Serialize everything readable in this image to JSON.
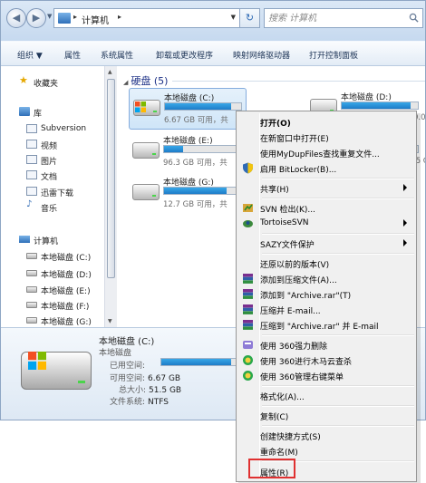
{
  "address": {
    "path": "计算机",
    "search_placeholder": "搜索 计算机"
  },
  "toolbar": {
    "organize": "组织 ▼",
    "properties": "属性",
    "system_properties": "系统属性",
    "uninstall": "卸载或更改程序",
    "map_drive": "映射网络驱动器",
    "control_panel": "打开控制面板"
  },
  "nav": {
    "favorites": "收藏夹",
    "library": "库",
    "subversion": "Subversion",
    "videos": "视频",
    "pictures": "图片",
    "documents": "文档",
    "xunlei": "迅雷下载",
    "music": "音乐",
    "computer": "计算机",
    "drives": [
      "本地磁盘 (C:)",
      "本地磁盘 (D:)",
      "本地磁盘 (E:)",
      "本地磁盘 (F:)",
      "本地磁盘 (G:)"
    ]
  },
  "content": {
    "group_header": "硬盘 (5)",
    "drives": [
      {
        "name": "本地磁盘 (C:)",
        "free": "6.67 GB 可用，共",
        "used_fraction": 0.87
      },
      {
        "name": "本地磁盘 (E:)",
        "free": "96.3 GB 可用，共",
        "used_fraction": 0.25
      },
      {
        "name": "本地磁盘 (G:)",
        "free": "12.7 GB 可用，共",
        "used_fraction": 0.82
      },
      {
        "name": "本地磁盘 (D:)",
        "free": "0.0",
        "used_fraction": 0.9
      },
      {
        "name": "",
        "free": ".5 G",
        "used_fraction": 0.9
      }
    ]
  },
  "details": {
    "title": "本地磁盘 (C:)",
    "subtitle": "本地磁盘",
    "used_label": "已用空间:",
    "free_label": "可用空间:",
    "free_value": "6.67 GB",
    "total_label": "总大小:",
    "total_value": "51.5 GB",
    "fs_label": "文件系统:",
    "fs_value": "NTFS",
    "used_fraction": 0.87
  },
  "menu": {
    "open": "打开(O)",
    "open_new_window": "在新窗口中打开(E)",
    "mydupfiles": "使用MyDupFiles查找重复文件...",
    "bitlocker": "启用 BitLocker(B)...",
    "share": "共享(H)",
    "svn_checkout": "SVN 检出(K)...",
    "tortoisesvn": "TortoiseSVN",
    "sazy": "SAZY文件保护",
    "restore": "还原以前的版本(V)",
    "add_archive": "添加到压缩文件(A)...",
    "add_rar": "添加到 \"Archive.rar\"(T)",
    "compress_email": "压缩并 E-mail...",
    "compress_rar_email": "压缩到 \"Archive.rar\" 并 E-mail",
    "del_360": "使用 360强力删除",
    "scan_360": "使用 360进行木马云查杀",
    "manage_360": "使用 360管理右键菜单",
    "format": "格式化(A)...",
    "copy": "复制(C)",
    "create_shortcut": "创建快捷方式(S)",
    "rename": "重命名(M)",
    "properties": "属性(R)"
  },
  "colors": {
    "accent": "#1e7cc8",
    "highlight_box": "#e03131"
  }
}
